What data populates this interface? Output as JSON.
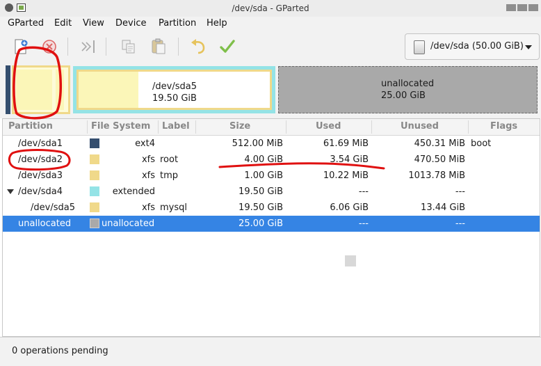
{
  "window": {
    "title": "/dev/sda - GParted"
  },
  "menu": {
    "items": [
      "GParted",
      "Edit",
      "View",
      "Device",
      "Partition",
      "Help"
    ]
  },
  "toolbar": {
    "icons": [
      "new-icon",
      "delete-icon",
      "resize-move-icon",
      "copy-icon",
      "paste-icon",
      "undo-icon",
      "apply-icon"
    ]
  },
  "device_selector": {
    "label": "/dev/sda (50.00 GiB)"
  },
  "disk_map": {
    "sda5": {
      "name": "/dev/sda5",
      "size": "19.50 GiB"
    },
    "unallocated": {
      "name": "unallocated",
      "size": "25.00 GiB"
    }
  },
  "columns": [
    "Partition",
    "File System",
    "Label",
    "Size",
    "Used",
    "Unused",
    "Flags"
  ],
  "rows": [
    {
      "partition": "/dev/sda1",
      "fs": "ext4",
      "label": "",
      "size": "512.00 MiB",
      "used": "61.69 MiB",
      "unused": "450.31 MiB",
      "flags": "boot",
      "color": "#344e6e"
    },
    {
      "partition": "/dev/sda2",
      "fs": "xfs",
      "label": "root",
      "size": "4.00 GiB",
      "used": "3.54 GiB",
      "unused": "470.50 MiB",
      "flags": "",
      "color": "#f0d98a"
    },
    {
      "partition": "/dev/sda3",
      "fs": "xfs",
      "label": "tmp",
      "size": "1.00 GiB",
      "used": "10.22 MiB",
      "unused": "1013.78 MiB",
      "flags": "",
      "color": "#f0d98a"
    },
    {
      "partition": "/dev/sda4",
      "fs": "extended",
      "label": "",
      "size": "19.50 GiB",
      "used": "---",
      "unused": "---",
      "flags": "",
      "color": "#94e3e6"
    },
    {
      "partition": "/dev/sda5",
      "fs": "xfs",
      "label": "mysql",
      "size": "19.50 GiB",
      "used": "6.06 GiB",
      "unused": "13.44 GiB",
      "flags": "",
      "color": "#f0d98a"
    },
    {
      "partition": "unallocated",
      "fs": "unallocated",
      "label": "",
      "size": "25.00 GiB",
      "used": "---",
      "unused": "---",
      "flags": "",
      "color": "#a9a9a9"
    }
  ],
  "status": {
    "text": "0 operations pending"
  },
  "colors": {
    "selection": "#3584e4",
    "annotation": "#e01010",
    "xfs": "#f0d98a",
    "ext4": "#344e6e",
    "extended": "#94e3e6",
    "unallocated": "#a9a9a9"
  }
}
